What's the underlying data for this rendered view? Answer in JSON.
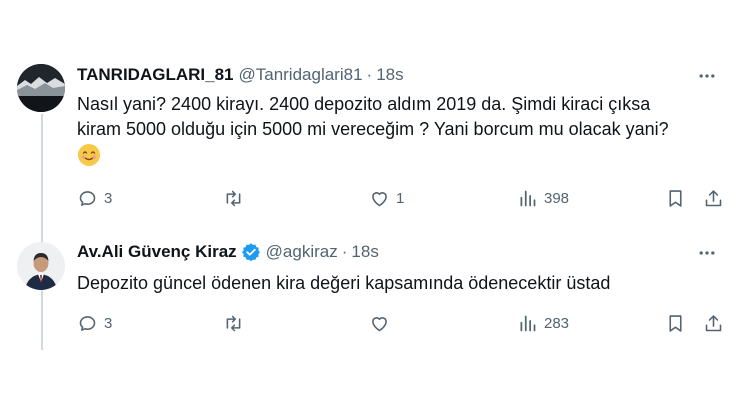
{
  "tweets": [
    {
      "display_name": "TANRIDAGLARI_81",
      "handle": "@Tanridaglari81",
      "separator": "·",
      "time": "18s",
      "text": "Nasıl yani? 2400 kirayı. 2400 depozito aldım 2019 da. Şimdi kiraci çıksa\nkiram 5000 olduğu için 5000 mi vereceğim ? Yani borcum mu olacak yani?",
      "emoji": "smiling-face-emoji",
      "verified": false,
      "replies": "3",
      "retweets": "",
      "likes": "1",
      "views": "398"
    },
    {
      "display_name": "Av.Ali Güvenç Kiraz",
      "handle": "@agkiraz",
      "separator": "·",
      "time": "18s",
      "text": "Depozito güncel ödenen kira değeri kapsamında ödenecektir üstad",
      "verified": true,
      "replies": "3",
      "retweets": "",
      "likes": "",
      "views": "283"
    }
  ],
  "colors": {
    "text_primary": "#0f1419",
    "text_secondary": "#536471",
    "verified_blue": "#1d9bf0",
    "thread_line": "#cfd9de"
  },
  "icons": [
    "more-icon",
    "reply-icon",
    "retweet-icon",
    "like-icon",
    "views-icon",
    "bookmark-icon",
    "share-icon",
    "verified-badge-icon"
  ]
}
